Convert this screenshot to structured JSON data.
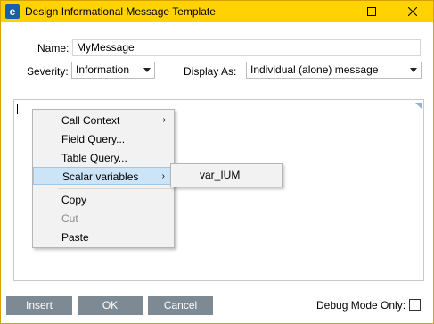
{
  "window": {
    "title": "Design Informational Message Template",
    "app_icon_letter": "e"
  },
  "form": {
    "name_label": "Name:",
    "name_value": "MyMessage",
    "severity_label": "Severity:",
    "severity_value": "Information",
    "display_label": "Display As:",
    "display_value": "Individual (alone) message"
  },
  "context_menu": {
    "call_context": "Call Context",
    "field_query": "Field Query...",
    "table_query": "Table Query...",
    "scalar_variables": "Scalar variables",
    "copy": "Copy",
    "cut": "Cut",
    "paste": "Paste",
    "submenu_arrow": "›"
  },
  "submenu": {
    "item": "var_IUM"
  },
  "buttons": {
    "insert": "Insert",
    "ok": "OK",
    "cancel": "Cancel"
  },
  "debug": {
    "label": "Debug Mode Only:",
    "checked": false
  },
  "colors": {
    "titlebar": "#ffd200",
    "button": "#7d8a94",
    "highlight": "#cce4f7"
  }
}
